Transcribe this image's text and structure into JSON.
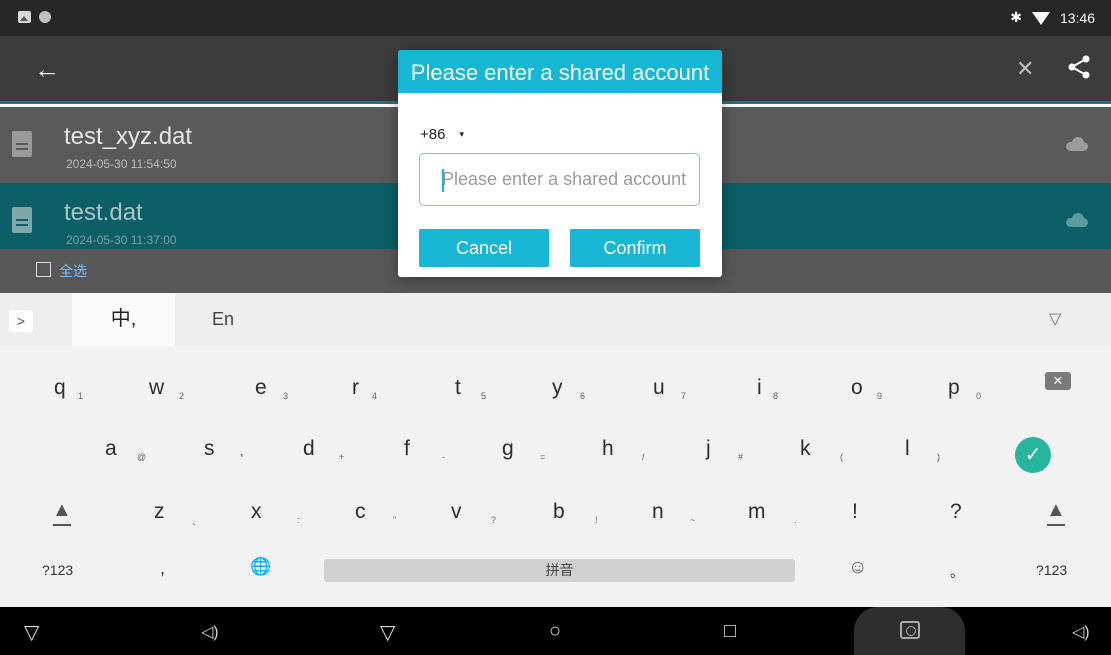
{
  "status_bar": {
    "time": "13:46",
    "bluetooth_icon": "bluetooth-icon",
    "wifi_icon": "wifi-icon"
  },
  "app_bar": {
    "back_icon": "←",
    "close_icon": "✕"
  },
  "files": [
    {
      "name": "test_xyz.dat",
      "date": "2024-05-30 11:54:50"
    },
    {
      "name": "test.dat",
      "date": "2024-05-30 11:37:00"
    }
  ],
  "select_all_label": "全选",
  "dialog": {
    "title": "Please enter a shared account",
    "country_code": "+86",
    "country_arrow": "▾",
    "account_placeholder": "Please enter a shared account",
    "cancel_label": "Cancel",
    "confirm_label": "Confirm"
  },
  "keyboard": {
    "collapse_label": ">",
    "tab_zh_label": "中,",
    "tab_en_label": "En",
    "hide_icon": "▽",
    "row1": [
      {
        "k": "q",
        "s": "1"
      },
      {
        "k": "w",
        "s": "2"
      },
      {
        "k": "e",
        "s": "3"
      },
      {
        "k": "r",
        "s": "4"
      },
      {
        "k": "t",
        "s": "5"
      },
      {
        "k": "y",
        "s": "6"
      },
      {
        "k": "u",
        "s": "7"
      },
      {
        "k": "i",
        "s": "8"
      },
      {
        "k": "o",
        "s": "9"
      },
      {
        "k": "p",
        "s": "0"
      }
    ],
    "row2": [
      {
        "k": "a",
        "s": "@"
      },
      {
        "k": "s",
        "s": "*"
      },
      {
        "k": "d",
        "s": "+"
      },
      {
        "k": "f",
        "s": "-"
      },
      {
        "k": "g",
        "s": "="
      },
      {
        "k": "h",
        "s": "/"
      },
      {
        "k": "j",
        "s": "#"
      },
      {
        "k": "k",
        "s": "("
      },
      {
        "k": "l",
        "s": ")"
      }
    ],
    "row3": [
      {
        "k": "z",
        "s": "、"
      },
      {
        "k": "x",
        "s": ":"
      },
      {
        "k": "c",
        "s": "\""
      },
      {
        "k": "v",
        "s": "?"
      },
      {
        "k": "b",
        "s": "!"
      },
      {
        "k": "n",
        "s": "~"
      },
      {
        "k": "m",
        "s": "."
      },
      {
        "k": "!",
        "s": ""
      },
      {
        "k": "?",
        "s": ""
      }
    ],
    "backspace_label": "✕",
    "enter_label": "✓",
    "shift_label": "▲",
    "sym_left_label": "?123",
    "comma_label": ",",
    "globe_label": "🌐",
    "space_label": "拼音",
    "emoji_label": "☺",
    "period_label": "。",
    "sym_right_label": "?123"
  },
  "nav_bar": {
    "left_down_icon": "▽",
    "left_vol_icon": "◁)",
    "back_icon": "▽",
    "home_icon": "○",
    "recent_icon": "□",
    "right_vol_icon": "◁)"
  }
}
